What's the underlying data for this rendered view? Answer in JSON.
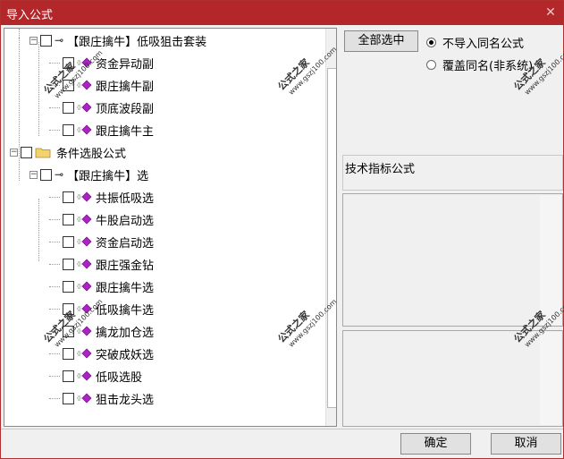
{
  "window": {
    "title": "导入公式",
    "close_glyph": "✕"
  },
  "tree": {
    "items": [
      {
        "label": "【跟庄擒牛】低吸狙击套装",
        "icon": "key-icon"
      },
      {
        "label": "资金异动副",
        "icon": "diamond-icon"
      },
      {
        "label": "跟庄擒牛副",
        "icon": "diamond-icon"
      },
      {
        "label": "顶底波段副",
        "icon": "diamond-icon"
      },
      {
        "label": "跟庄擒牛主",
        "icon": "diamond-icon"
      },
      {
        "label": "条件选股公式",
        "icon": "folder-icon"
      },
      {
        "label": "【跟庄擒牛】选",
        "icon": "key-icon"
      },
      {
        "label": "共振低吸选",
        "icon": "diamond-icon"
      },
      {
        "label": "牛股启动选",
        "icon": "diamond-icon"
      },
      {
        "label": "资金启动选",
        "icon": "diamond-icon"
      },
      {
        "label": "跟庄强金钻",
        "icon": "diamond-icon"
      },
      {
        "label": "跟庄擒牛选",
        "icon": "diamond-icon"
      },
      {
        "label": "低吸擒牛选",
        "icon": "diamond-icon"
      },
      {
        "label": "擒龙加仓选",
        "icon": "diamond-icon"
      },
      {
        "label": "突破成妖选",
        "icon": "diamond-icon"
      },
      {
        "label": "低吸选股",
        "icon": "diamond-icon"
      },
      {
        "label": "狙击龙头选",
        "icon": "diamond-icon"
      }
    ]
  },
  "watermark": {
    "text": "公式之家",
    "url": "www.gszj100.com"
  },
  "options": {
    "select_all_label": "全部选中",
    "radio_skip_label": "不导入同名公式",
    "radio_overwrite_label": "覆盖同名(非系统)",
    "selected": "skip"
  },
  "info": {
    "formula_type_label": "技术指标公式"
  },
  "buttons": {
    "ok_label": "确定",
    "cancel_label": "取消"
  },
  "colors": {
    "titlebar": "#b3262a",
    "diamond": "#b020c8",
    "folder": "#f2d36b"
  }
}
